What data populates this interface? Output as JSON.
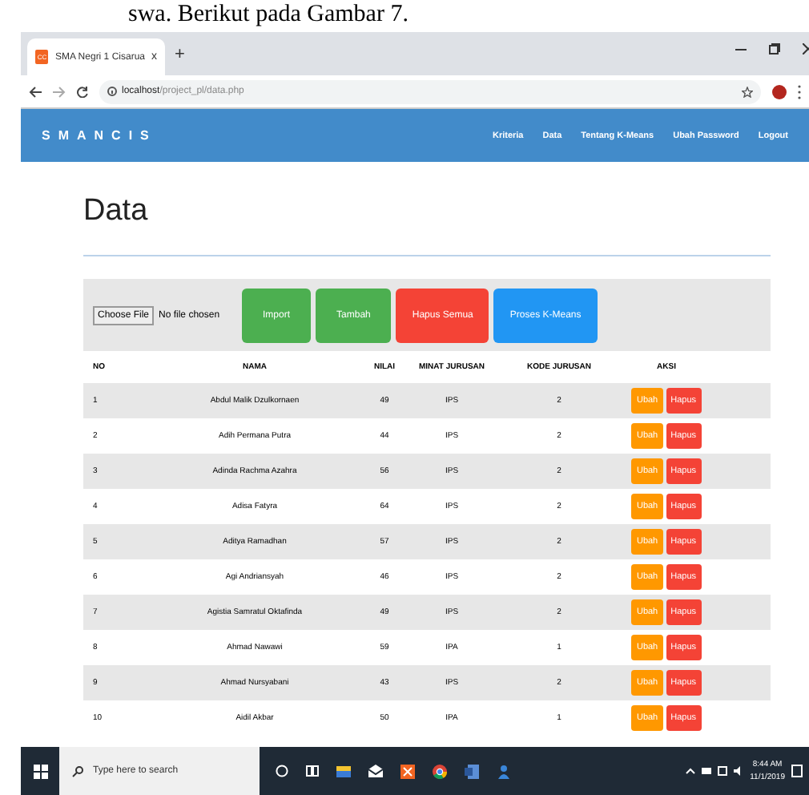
{
  "document_caption": "swa. Berikut pada Gambar 7.",
  "browser": {
    "tab": {
      "favicon": "CC",
      "title": "SMA Negri 1 Cisarua",
      "close": "x",
      "new_tab": "+"
    },
    "url_host": "localhost",
    "url_path": "/project_pl/data.php"
  },
  "navbar": {
    "brand": "SMANCIS",
    "items": [
      {
        "label": "Kriteria"
      },
      {
        "label": "Data"
      },
      {
        "label": "Tentang K-Means"
      },
      {
        "label": "Ubah Password"
      },
      {
        "label": "Logout"
      }
    ]
  },
  "page": {
    "heading": "Data",
    "file_input": {
      "button": "Choose File",
      "status": "No file chosen"
    },
    "buttons": [
      {
        "label": "Import",
        "kind": "success"
      },
      {
        "label": "Tambah",
        "kind": "success"
      },
      {
        "label": "Hapus Semua",
        "kind": "danger"
      },
      {
        "label": "Proses K-Means",
        "kind": "info"
      }
    ],
    "table": {
      "columns": [
        "NO",
        "NAMA",
        "NILAI",
        "MINAT JURUSAN",
        "KODE JURUSAN",
        "AKSI"
      ],
      "rows": [
        {
          "no": "1",
          "nama": "Abdul Malik Dzulkornaen",
          "nilai": "49",
          "minat": "IPS",
          "kode": "2",
          "actions": [
            "Ubah",
            "Hapus"
          ]
        },
        {
          "no": "2",
          "nama": "Adih Permana Putra",
          "nilai": "44",
          "minat": "IPS",
          "kode": "2",
          "actions": [
            "Ubah",
            "Hapus"
          ]
        },
        {
          "no": "3",
          "nama": "Adinda Rachma Azahra",
          "nilai": "56",
          "minat": "IPS",
          "kode": "2",
          "actions": [
            "Ubah",
            "Hapus"
          ]
        },
        {
          "no": "4",
          "nama": "Adisa Fatyra",
          "nilai": "64",
          "minat": "IPS",
          "kode": "2",
          "actions": [
            "Ubah",
            "Hapus"
          ]
        },
        {
          "no": "5",
          "nama": "Aditya Ramadhan",
          "nilai": "57",
          "minat": "IPS",
          "kode": "2",
          "actions": [
            "Ubah",
            "Hapus"
          ]
        },
        {
          "no": "6",
          "nama": "Agi Andriansyah",
          "nilai": "46",
          "minat": "IPS",
          "kode": "2",
          "actions": [
            "Ubah",
            "Hapus"
          ]
        },
        {
          "no": "7",
          "nama": "Agistia Samratul Oktafinda",
          "nilai": "49",
          "minat": "IPS",
          "kode": "2",
          "actions": [
            "Ubah",
            "Hapus"
          ]
        },
        {
          "no": "8",
          "nama": "Ahmad Nawawi",
          "nilai": "59",
          "minat": "IPA",
          "kode": "1",
          "actions": [
            "Ubah",
            "Hapus"
          ]
        },
        {
          "no": "9",
          "nama": "Ahmad Nursyabani",
          "nilai": "43",
          "minat": "IPS",
          "kode": "2",
          "actions": [
            "Ubah",
            "Hapus"
          ]
        },
        {
          "no": "10",
          "nama": "Aidil Akbar",
          "nilai": "50",
          "minat": "IPA",
          "kode": "1",
          "actions": [
            "Ubah",
            "Hapus"
          ]
        }
      ]
    }
  },
  "taskbar": {
    "search_placeholder": "Type here to search",
    "time": "8:44 AM",
    "date": "11/1/2019"
  }
}
